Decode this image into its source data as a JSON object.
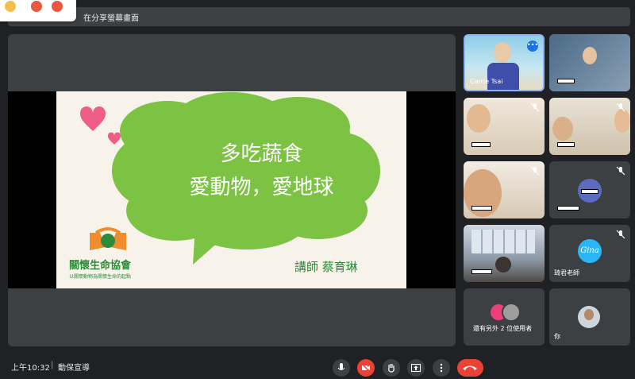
{
  "top_bar": {
    "presenting_text": "在分享螢幕畫面"
  },
  "slide": {
    "line1": "多吃蔬食",
    "line2": "愛動物，愛地球",
    "org_name": "關懷生命協會",
    "org_motto": "以關懷動物為關懷生命的起點",
    "speaker": "講師 蔡育琳"
  },
  "participants": [
    {
      "name": "Carrie Tsai",
      "muted": false,
      "active": true
    },
    {
      "name": "",
      "muted": false
    },
    {
      "name": "",
      "muted": true
    },
    {
      "name": "",
      "muted": true
    },
    {
      "name": "",
      "muted": true
    },
    {
      "name": "",
      "muted": true
    },
    {
      "name": "",
      "muted": false
    },
    {
      "name": "琦君老師",
      "muted": true,
      "avatar_text": "Gina"
    },
    {
      "name": "還有另外 2 位使用者",
      "muted": false
    },
    {
      "name": "你",
      "muted": false
    }
  ],
  "bottom_bar": {
    "time": "上午10:32",
    "separator": "|",
    "meeting_name": "動保宣導"
  },
  "colors": {
    "background": "#202124",
    "surface": "#3c4043",
    "end_call": "#ea4335",
    "camera_off": "#ea4335",
    "slide_green": "#2e8b3a",
    "cloud_green": "#7cc243",
    "active_border": "#8ab4f8"
  },
  "icons": {
    "mic": "mic-icon",
    "camera": "camera-off-icon",
    "hand": "raise-hand-icon",
    "present": "present-icon",
    "more": "more-vert-icon",
    "end": "end-call-icon"
  }
}
